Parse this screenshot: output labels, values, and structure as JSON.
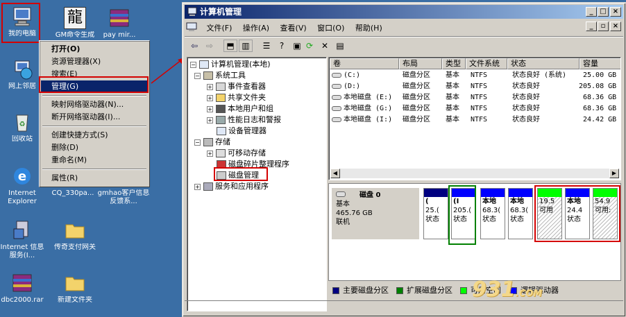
{
  "desktop": {
    "icons": [
      {
        "label": "我的电脑"
      },
      {
        "label": "GM命令生成"
      },
      {
        "label": "pay mir..."
      },
      {
        "label": "网上邻居"
      },
      {
        "label": "回收站"
      },
      {
        "label": "Internet Explorer"
      },
      {
        "label": "CQ_330pa..."
      },
      {
        "label": "gmhao客户信息反馈系..."
      },
      {
        "label": "Internet 信息服务(I..."
      },
      {
        "label": "传奇支付网关"
      },
      {
        "label": "dbc2000.rar"
      },
      {
        "label": "新建文件夹"
      }
    ]
  },
  "context_menu": {
    "items": [
      "打开(O)",
      "资源管理器(X)",
      "搜索(E)",
      "管理(G)",
      "映射网络驱动器(N)...",
      "断开网络驱动器(I)...",
      "创建快捷方式(S)",
      "删除(D)",
      "重命名(M)",
      "属性(R)"
    ]
  },
  "window": {
    "title": "计算机管理",
    "title_buttons": {
      "min": "_",
      "max": "□",
      "close": "×"
    },
    "menus": [
      "文件(F)",
      "操作(A)",
      "查看(V)",
      "窗口(O)",
      "帮助(H)"
    ],
    "inner_buttons": {
      "min": "_",
      "restore": "▫",
      "close": "×"
    }
  },
  "tree": {
    "root": "计算机管理(本地)",
    "system_tools": "系统工具",
    "event_viewer": "事件查看器",
    "shared_folders": "共享文件夹",
    "local_users": "本地用户和组",
    "perf_logs": "性能日志和警报",
    "device_manager": "设备管理器",
    "storage": "存储",
    "removable": "可移动存储",
    "defrag": "磁盘碎片整理程序",
    "disk_mgmt": "磁盘管理",
    "services": "服务和应用程序"
  },
  "volumes": {
    "headers": [
      "卷",
      "布局",
      "类型",
      "文件系统",
      "状态",
      "容量"
    ],
    "rows": [
      {
        "vol": "(C:)",
        "layout": "磁盘分区",
        "type": "基本",
        "fs": "NTFS",
        "status": "状态良好 (系统)",
        "cap": "25.00 GB"
      },
      {
        "vol": "(D:)",
        "layout": "磁盘分区",
        "type": "基本",
        "fs": "NTFS",
        "status": "状态良好",
        "cap": "205.08 GB"
      },
      {
        "vol": "本地磁盘 (E:)",
        "layout": "磁盘分区",
        "type": "基本",
        "fs": "NTFS",
        "status": "状态良好",
        "cap": "68.36 GB"
      },
      {
        "vol": "本地磁盘 (G:)",
        "layout": "磁盘分区",
        "type": "基本",
        "fs": "NTFS",
        "status": "状态良好",
        "cap": "68.36 GB"
      },
      {
        "vol": "本地磁盘 (I:)",
        "layout": "磁盘分区",
        "type": "基本",
        "fs": "NTFS",
        "status": "状态良好",
        "cap": "24.42 GB"
      }
    ]
  },
  "disk": {
    "name": "磁盘 0",
    "type": "基本",
    "size": "465.76 GB",
    "state": "联机",
    "partitions": [
      {
        "l1": "(",
        "l2": "25.(",
        "l3": "状态",
        "color": "#000080"
      },
      {
        "l1": "(I",
        "l2": "205.(",
        "l3": "状态",
        "color": "#0000ff"
      },
      {
        "l1": "本地",
        "l2": "68.3(",
        "l3": "状态",
        "color": "#0000ff"
      },
      {
        "l1": "本地",
        "l2": "68.3(",
        "l3": "状态",
        "color": "#0000ff"
      },
      {
        "l1": "",
        "l2": "19.5",
        "l3": "可用",
        "color": "#00ff00"
      },
      {
        "l1": "本地",
        "l2": "24.4",
        "l3": "状态",
        "color": "#0000ff"
      },
      {
        "l1": "",
        "l2": "54.9",
        "l3": "可用:",
        "color": "#00ff00"
      }
    ]
  },
  "legend": [
    {
      "label": "主要磁盘分区",
      "color": "#000080"
    },
    {
      "label": "扩展磁盘分区",
      "color": "#008000"
    },
    {
      "label": "可用空间",
      "color": "#00ff00"
    },
    {
      "label": "逻辑驱动器",
      "color": "#0000ff"
    }
  ],
  "watermark": {
    "main": "931",
    "sub": ".COM"
  }
}
